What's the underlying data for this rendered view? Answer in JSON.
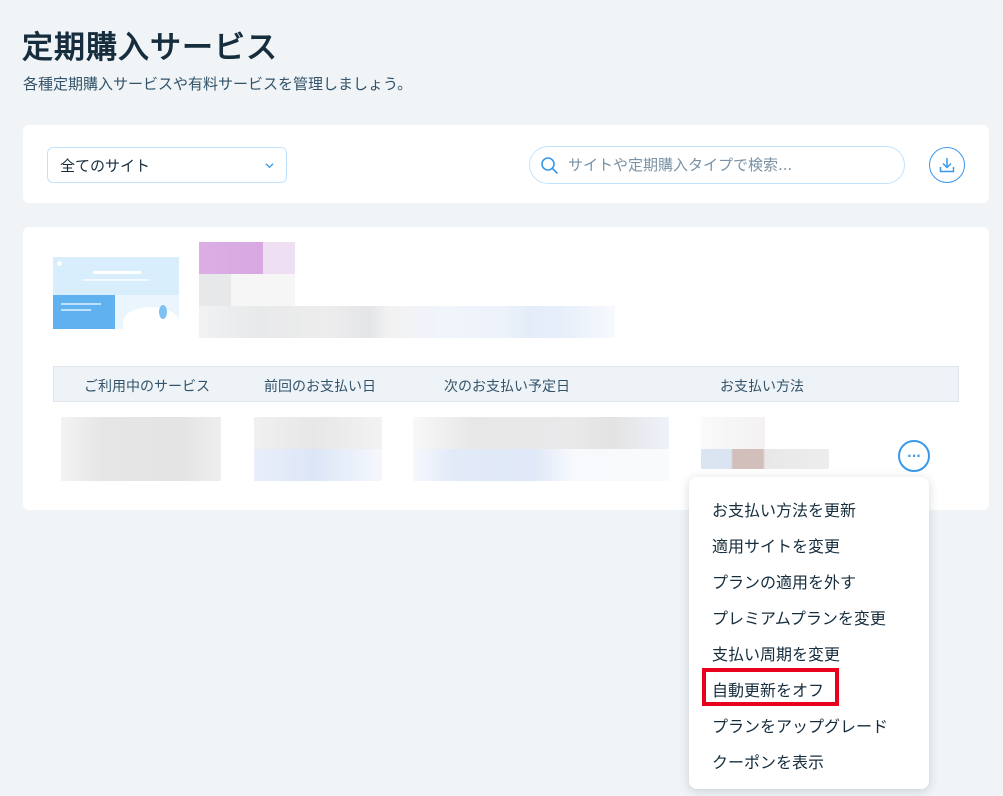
{
  "page": {
    "title": "定期購入サービス",
    "subtitle": "各種定期購入サービスや有料サービスを管理しましょう。"
  },
  "filters": {
    "site_select_value": "全てのサイト",
    "search_placeholder": "サイトや定期購入タイプで検索...",
    "icons": {
      "select": "chevron-down-icon",
      "search": "search-icon",
      "download": "download-icon"
    }
  },
  "table": {
    "columns": [
      "ご利用中のサービス",
      "前回のお支払い日",
      "次のお支払い予定日",
      "お支払い方法"
    ]
  },
  "row_actions": {
    "more_button_label": "···",
    "menu_items": [
      "お支払い方法を更新",
      "適用サイトを変更",
      "プランの適用を外す",
      "プレミアムプランを変更",
      "支払い周期を変更",
      "自動更新をオフ",
      "プランをアップグレード",
      "クーポンを表示"
    ],
    "highlighted_item": "自動更新をオフ"
  },
  "colors": {
    "accent": "#3899ec",
    "highlight": "#e8001c",
    "background": "#f0f4f7"
  }
}
